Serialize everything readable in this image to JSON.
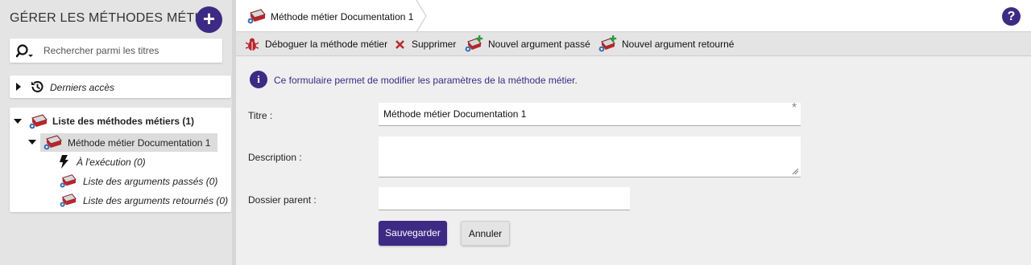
{
  "sidebar": {
    "title": "GÉRER LES MÉTHODES MÉTIER",
    "add_label": "+",
    "search_placeholder": "Rechercher parmi les titres",
    "recent_label": "Derniers accès",
    "tree": {
      "root_label": "Liste des méthodes métiers (1)",
      "child_label": "Méthode métier Documentation 1",
      "items": [
        {
          "label": "À l'exécution (0)",
          "icon": "lightning-icon"
        },
        {
          "label": "Liste des arguments passés (0)",
          "icon": "book-gear-icon"
        },
        {
          "label": "Liste des arguments retournés (0)",
          "icon": "book-gear-icon"
        }
      ]
    }
  },
  "header": {
    "breadcrumb": "Méthode métier Documentation 1",
    "help_label": "?"
  },
  "toolbar": {
    "debug_label": "Déboguer la méthode métier",
    "delete_label": "Supprimer",
    "new_passed_label": "Nouvel argument passé",
    "new_returned_label": "Nouvel argument retourné"
  },
  "form": {
    "info_text": "Ce formulaire permet de modifier les paramètres de la méthode métier.",
    "title_label": "Titre :",
    "title_value": "Méthode métier Documentation 1",
    "required_mark": "*",
    "description_label": "Description :",
    "description_value": "",
    "parent_label": "Dossier parent :",
    "parent_value": "",
    "save_label": "Sauvegarder",
    "cancel_label": "Annuler"
  },
  "colors": {
    "accent": "#3c2a84",
    "book_red": "#b7262b",
    "gear_blue": "#3a6fb0",
    "plus_green": "#2e9a3c"
  }
}
